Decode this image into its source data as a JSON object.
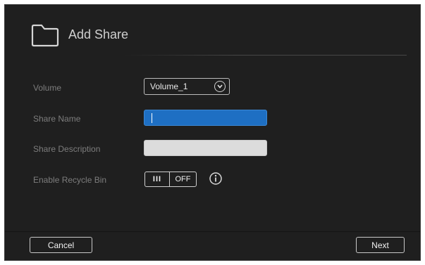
{
  "dialog": {
    "title": "Add Share",
    "title_icon": "folder-icon"
  },
  "form": {
    "volume": {
      "label": "Volume",
      "selected": "Volume_1",
      "icon": "chevron-down-icon"
    },
    "share_name": {
      "label": "Share Name",
      "value": ""
    },
    "share_description": {
      "label": "Share Description",
      "value": ""
    },
    "recycle_bin": {
      "label": "Enable Recycle Bin",
      "handle": "III",
      "state": "OFF",
      "info_icon": "info-icon"
    }
  },
  "footer": {
    "cancel_label": "Cancel",
    "next_label": "Next"
  },
  "colors": {
    "background": "#1f1f1f",
    "active_input": "#1e6fc3",
    "inactive_input": "#dcdcdc"
  }
}
